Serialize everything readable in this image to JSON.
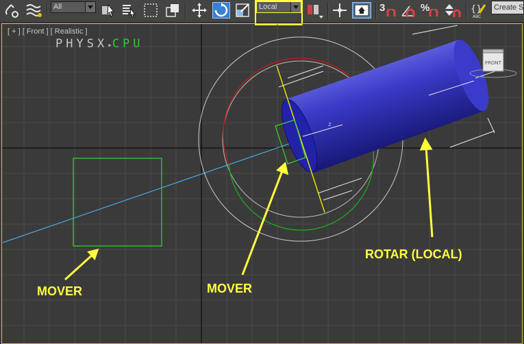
{
  "toolbar": {
    "filter_value": "All",
    "coord_value": "Local",
    "snap_angle_label": "3",
    "percent_snap_label": "%",
    "create_selection_value": "Create Se"
  },
  "viewport": {
    "label": "[ + ] [ Front ] [ Realistic ]",
    "physx_a": "PHYSX",
    "physx_b": "CPU",
    "gizmo_axis": "z",
    "viewcube_label": "FRONT"
  },
  "annotations": {
    "mover_left": "MOVER",
    "mover_center": "MOVER",
    "rotar": "ROTAR (LOCAL)"
  },
  "colors": {
    "accent_yellow": "#ffff40",
    "helper_green": "#3ad33a",
    "cylinder_blue": "#2a2ab8",
    "grid_line": "#4a4a4a"
  }
}
